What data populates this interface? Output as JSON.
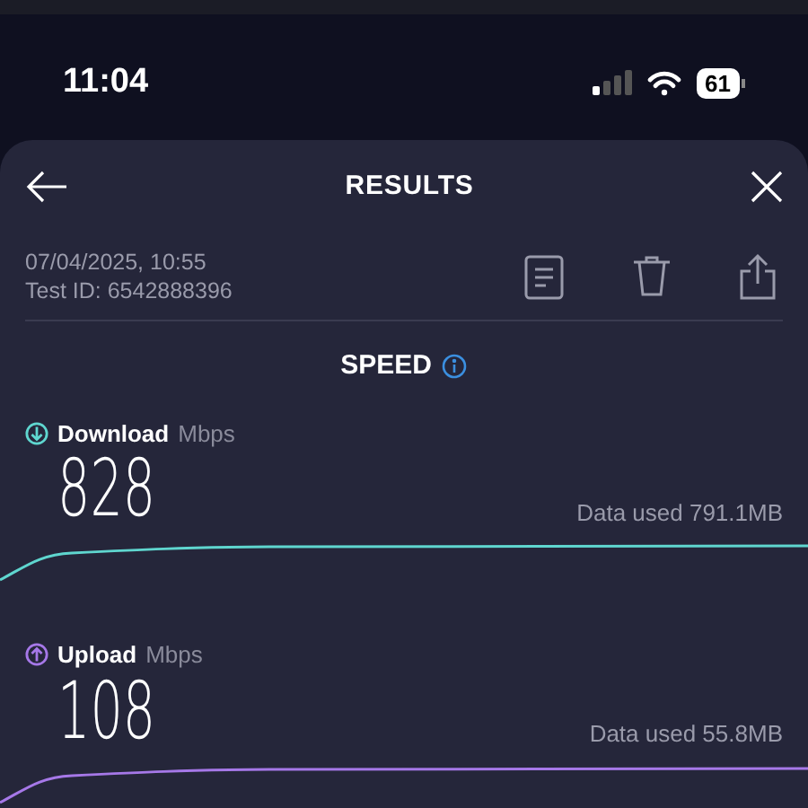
{
  "status_bar": {
    "time": "11:04",
    "battery": "61"
  },
  "header": {
    "title": "RESULTS"
  },
  "meta": {
    "date": "07/04/2025, 10:55",
    "test_id": "Test ID: 6542888396"
  },
  "section": {
    "title": "SPEED"
  },
  "results": [
    {
      "kind": "download",
      "label": "Download",
      "unit": "Mbps",
      "value": "828",
      "data_used": "Data used 791.1MB",
      "color": "#5fd6cf"
    },
    {
      "kind": "upload",
      "label": "Upload",
      "unit": "Mbps",
      "value": "108",
      "data_used": "Data used 55.8MB",
      "color": "#a678e8"
    }
  ]
}
